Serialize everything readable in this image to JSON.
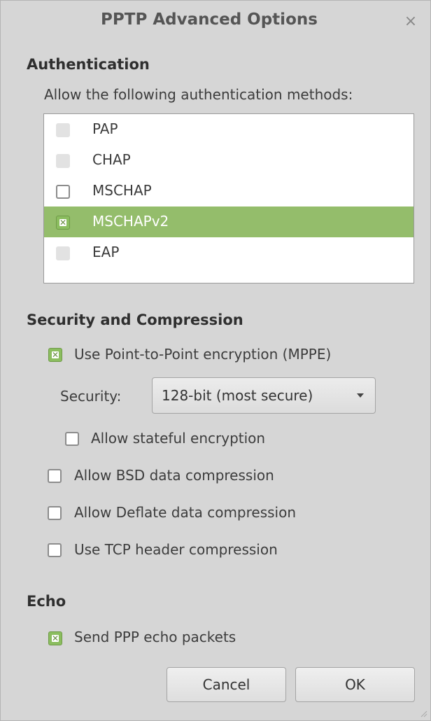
{
  "window": {
    "title": "PPTP Advanced Options",
    "close_symbol": "×"
  },
  "authentication": {
    "heading": "Authentication",
    "description": "Allow the following authentication methods:",
    "methods": [
      {
        "label": "PAP",
        "state": "disabled"
      },
      {
        "label": "CHAP",
        "state": "disabled"
      },
      {
        "label": "MSCHAP",
        "state": "unchecked"
      },
      {
        "label": "MSCHAPv2",
        "state": "checked",
        "selected": true
      },
      {
        "label": "EAP",
        "state": "disabled"
      }
    ]
  },
  "security": {
    "heading": "Security and Compression",
    "mppe_label": "Use Point-to-Point encryption (MPPE)",
    "mppe_checked": true,
    "security_label": "Security:",
    "security_value": "128-bit (most secure)",
    "stateful_label": "Allow stateful encryption",
    "stateful_checked": false,
    "bsd_label": "Allow BSD data compression",
    "bsd_checked": false,
    "deflate_label": "Allow Deflate data compression",
    "deflate_checked": false,
    "tcp_label": "Use TCP header compression",
    "tcp_checked": false
  },
  "echo": {
    "heading": "Echo",
    "send_echo_label": "Send PPP echo packets",
    "send_echo_checked": true
  },
  "buttons": {
    "cancel": "Cancel",
    "ok": "OK"
  },
  "colors": {
    "selection": "#94bd6b",
    "check_green": "#8bbd5f",
    "dialog_bg": "#d6d6d6"
  }
}
